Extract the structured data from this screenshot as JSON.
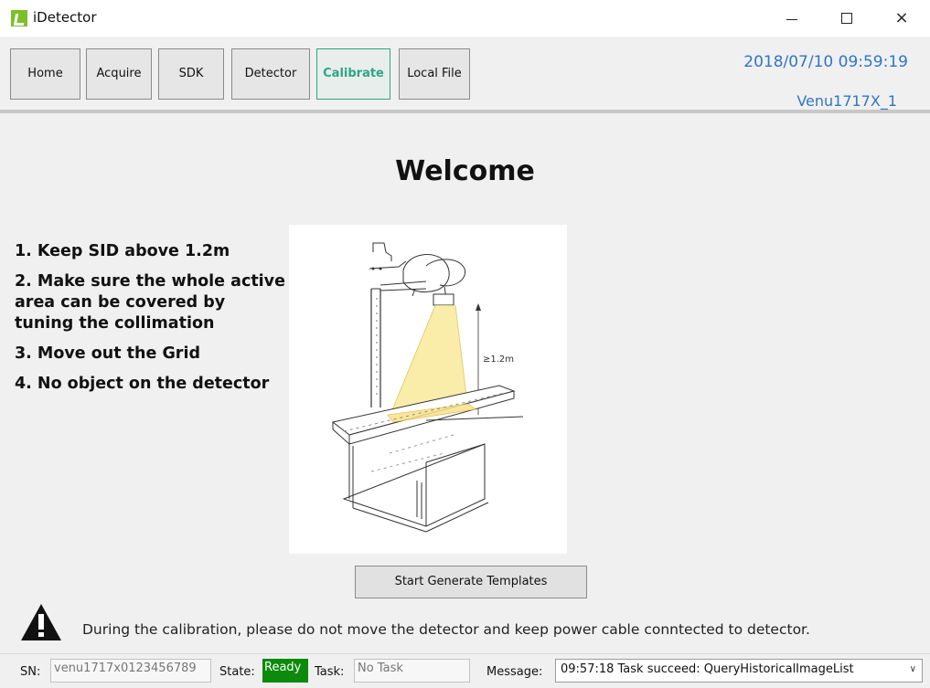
{
  "window": {
    "title": "iDetector",
    "icon": "idetector-logo-icon",
    "controls": {
      "minimize": "minimize-icon",
      "maximize": "maximize-icon",
      "close": "×"
    }
  },
  "toolbar": {
    "tabs": [
      {
        "label": "Home"
      },
      {
        "label": "Acquire"
      },
      {
        "label": "SDK"
      },
      {
        "label": "Detector"
      },
      {
        "label": "Calibrate",
        "active": true
      },
      {
        "label": "Local File"
      }
    ],
    "datetime": "2018/07/10 09:59:19",
    "device": "Venu1717X_1",
    "accent_color": "#2f76c6",
    "active_color": "#2aa784"
  },
  "main": {
    "heading": "Welcome",
    "steps": [
      "1. Keep SID above 1.2m",
      "2. Make sure the whole active area can be covered by tuning the collimation",
      "3. Move out the Grid",
      "4. No object on the detector"
    ],
    "illustration_label": "≥1.2m",
    "start_button": "Start Generate Templates",
    "warning_icon": "warning-icon",
    "warning_text": "During the calibration, please do not move the detector and keep power cable conntected to detector."
  },
  "status": {
    "sn_label": "SN:",
    "sn_value": "venu1717x0123456789",
    "state_label": "State:",
    "state_value": "Ready",
    "state_color": "#0b8a0b",
    "task_label": "Task:",
    "task_value": "No Task",
    "message_label": "Message:",
    "message_value": "09:57:18 Task succeed: QueryHistoricalImageList"
  }
}
